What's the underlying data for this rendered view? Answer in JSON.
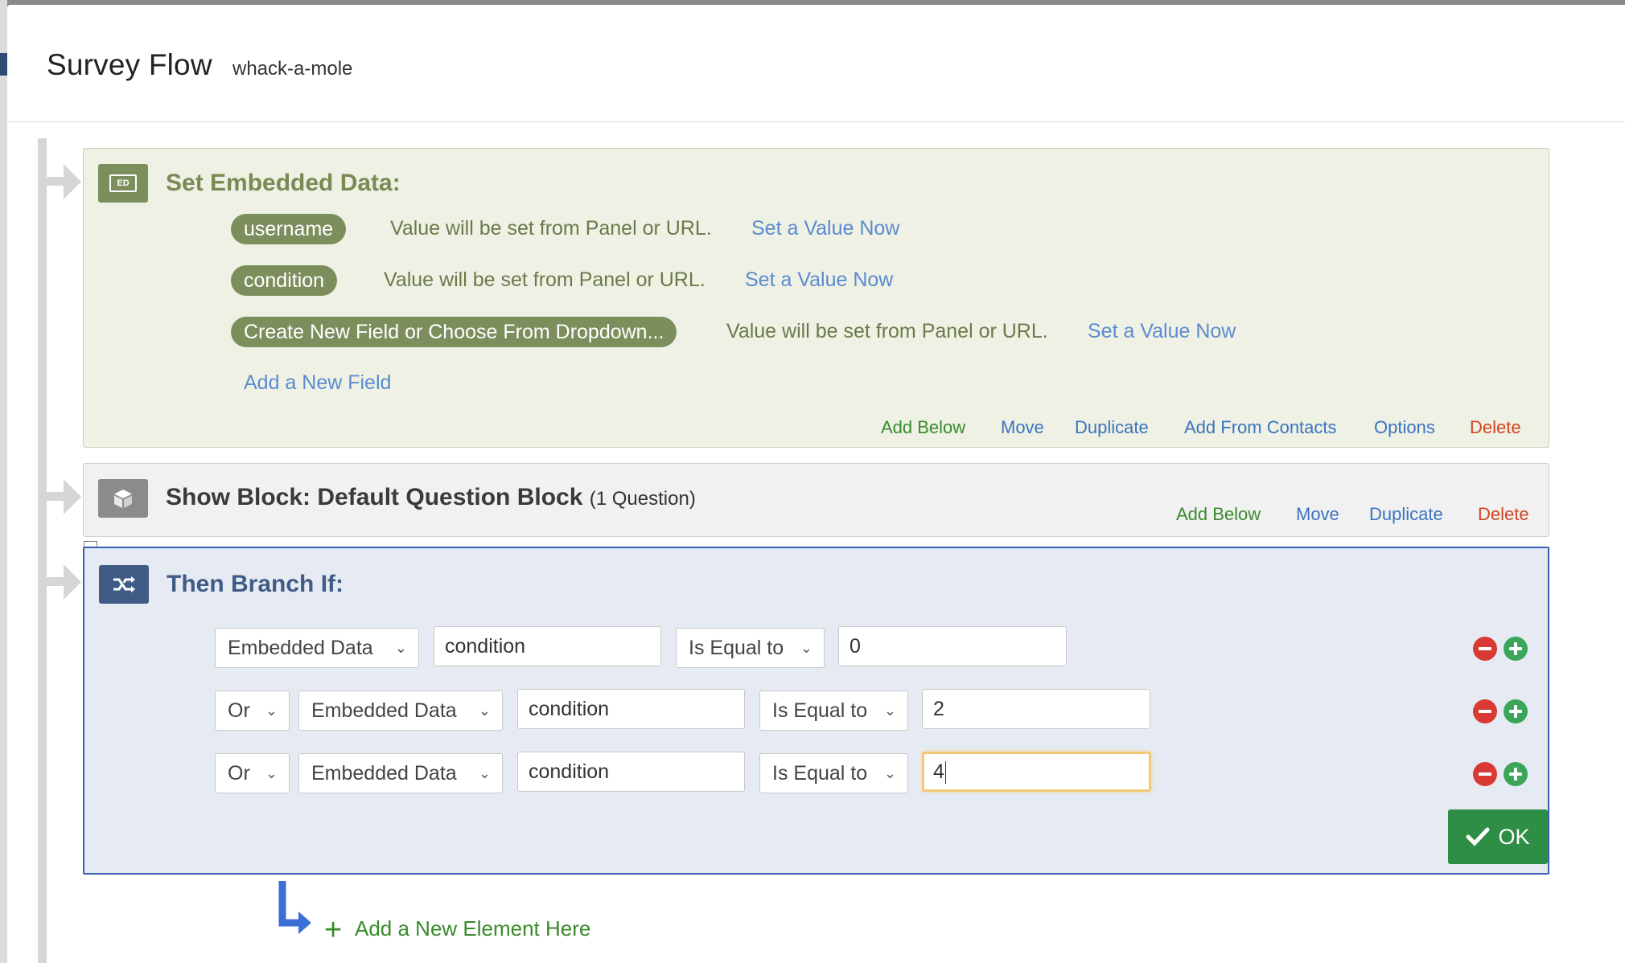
{
  "header": {
    "title": "Survey Flow",
    "subtitle": "whack-a-mole"
  },
  "embedded_data": {
    "icon_text": "ED",
    "title": "Set Embedded Data:",
    "fields": [
      {
        "name": "username",
        "value_text": "Value will be set from Panel or URL.",
        "link": "Set a Value Now"
      },
      {
        "name": "condition",
        "value_text": "Value will be set from Panel or URL.",
        "link": "Set a Value Now"
      },
      {
        "name": "Create New Field or Choose From Dropdown...",
        "value_text": "Value will be set from Panel or URL.",
        "link": "Set a Value Now"
      }
    ],
    "add_field": "Add a New Field",
    "actions": {
      "add_below": "Add Below",
      "move": "Move",
      "duplicate": "Duplicate",
      "add_from_contacts": "Add From Contacts",
      "options": "Options",
      "delete": "Delete"
    }
  },
  "show_block": {
    "title": "Show Block: Default Question Block",
    "count": "(1 Question)",
    "actions": {
      "add_below": "Add Below",
      "move": "Move",
      "duplicate": "Duplicate",
      "delete": "Delete"
    }
  },
  "branch": {
    "title": "Then Branch If:",
    "collapse_symbol": "−",
    "conditions": [
      {
        "conjunction": "",
        "type": "Embedded Data",
        "field": "condition",
        "operator": "Is Equal to",
        "value": "0"
      },
      {
        "conjunction": "Or",
        "type": "Embedded Data",
        "field": "condition",
        "operator": "Is Equal to",
        "value": "2"
      },
      {
        "conjunction": "Or",
        "type": "Embedded Data",
        "field": "condition",
        "operator": "Is Equal to",
        "value": "4"
      }
    ],
    "ok_label": "OK"
  },
  "add_element": "Add a New Element Here",
  "colors": {
    "green": "#3a8a2c",
    "blue_link": "#5b8bd0",
    "red": "#d0441f",
    "ok_green": "#2e8e45",
    "branch_border": "#3a5fb6"
  }
}
